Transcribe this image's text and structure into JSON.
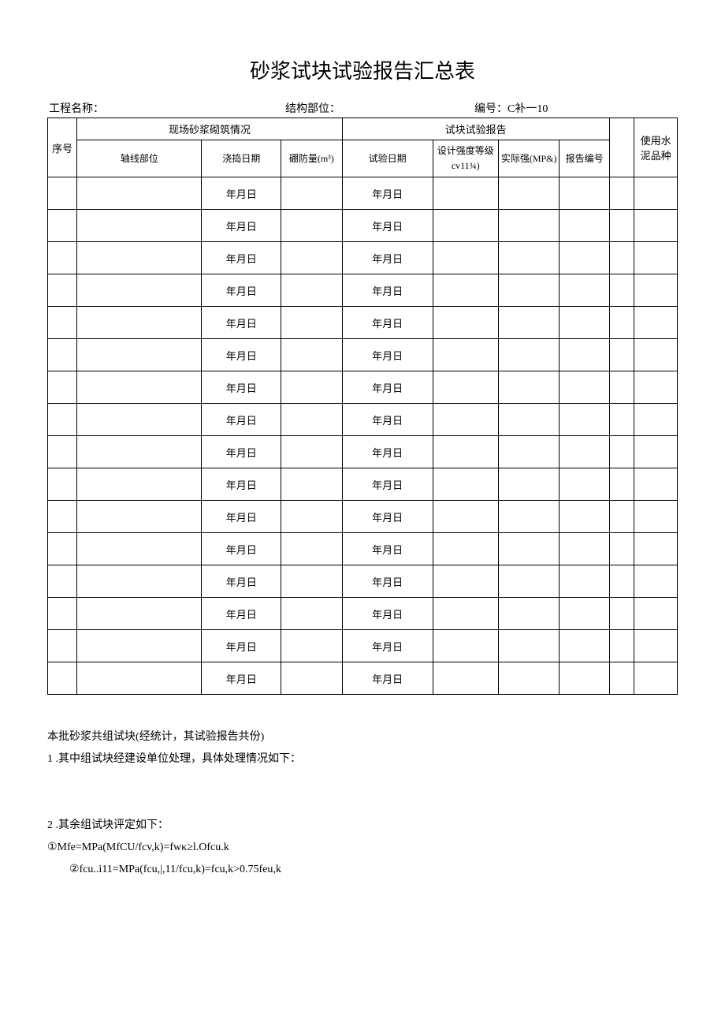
{
  "title": "砂浆试块试验报告汇总表",
  "meta": {
    "project_label": "工程名称：",
    "structure_label": "结构部位：",
    "serial_label": "编号：C补一10"
  },
  "headers": {
    "seq": "序号",
    "site_group": "现场砂浆砌筑情况",
    "report_group": "试块试验报告",
    "cement": "使用水泥品种",
    "axis": "轴线部位",
    "pour_date": "浇捣日期",
    "volume": "硼防量(m³)",
    "test_date": "试验日期",
    "design_grade": "设计强度等级cv11¾)",
    "actual_strength": "实际强(MP&)",
    "report_no": "报告编号"
  },
  "cell": {
    "ymd": "年月日"
  },
  "rows": 16,
  "notes": {
    "line1": "本批砂浆共组试块(经统计，其试验报告共份)",
    "line2": "1 .其中组试块经建设单位处理，具体处理情况如下：",
    "line3": "2 .其余组试块评定如下：",
    "line4": "①Mfe=MPa(MfCU/fcv,k)=fwκ≥l.Ofcu.k",
    "line5": "②fcu..i11=MPa(fcu,|,11/fcu,k)=fcu,k>0.75feu,k"
  }
}
